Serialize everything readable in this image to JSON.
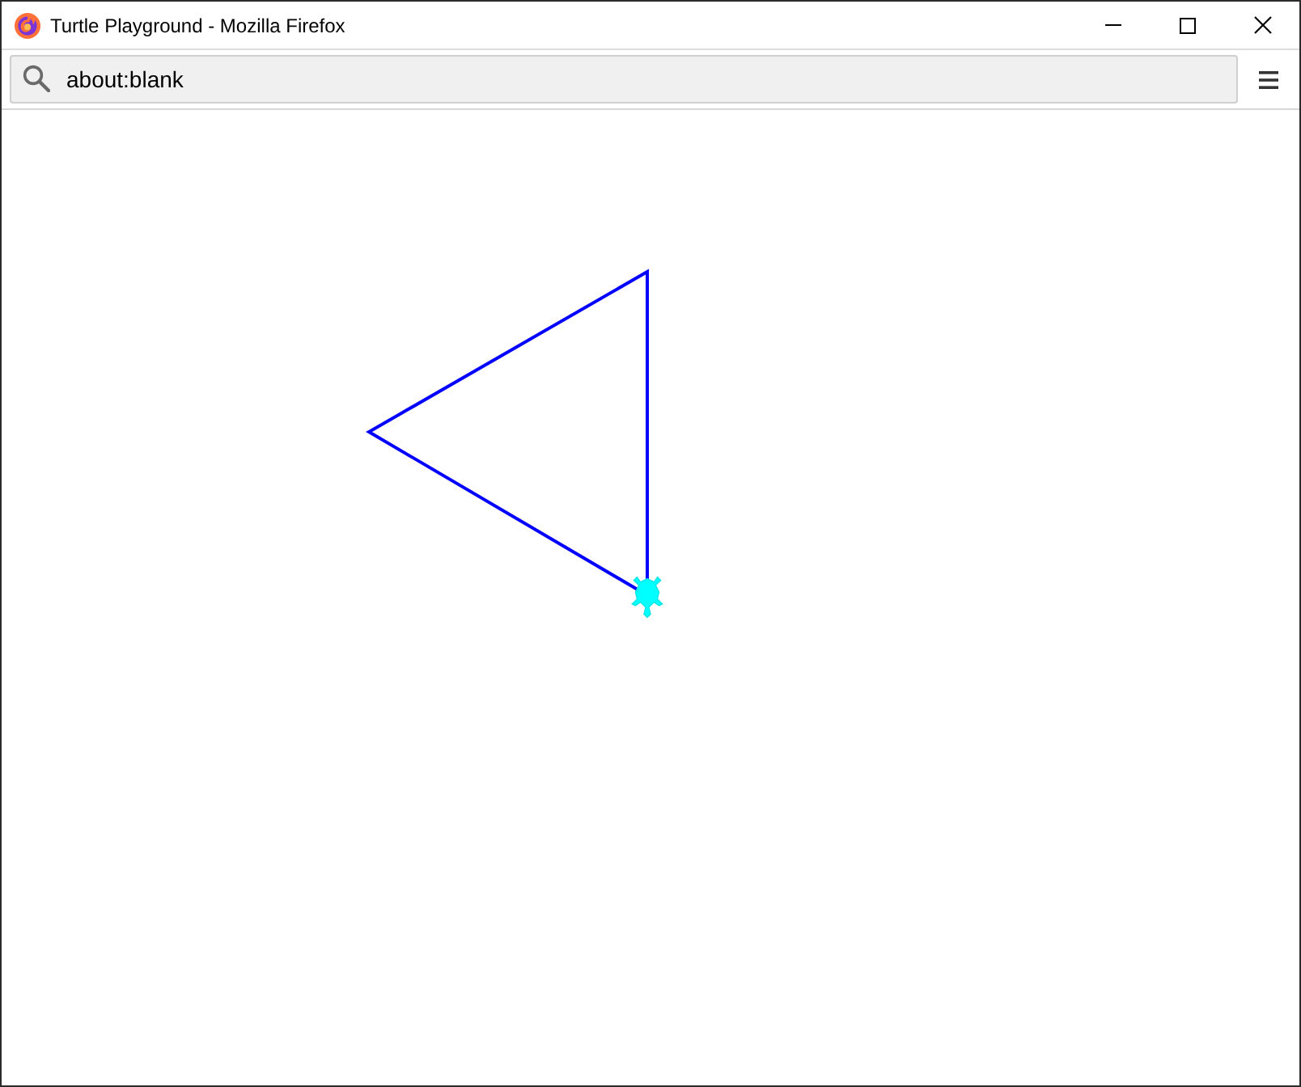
{
  "window": {
    "title": "Turtle Playground - Mozilla Firefox"
  },
  "address_bar": {
    "value": "about:blank"
  }
}
